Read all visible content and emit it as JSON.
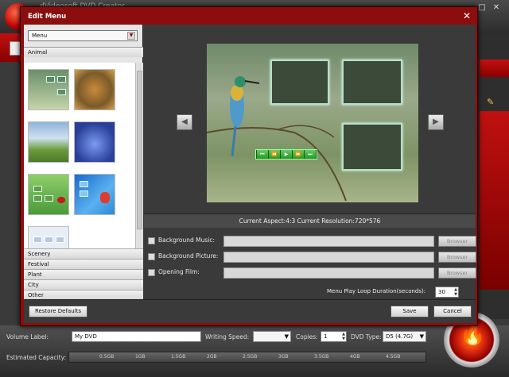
{
  "app": {
    "title": "dVideosoft DVD Creator",
    "minimize": "–",
    "maximize": "□",
    "close": "✕"
  },
  "dialog": {
    "title": "Edit Menu",
    "close": "✕",
    "menu_select": "Menu",
    "categories": [
      "Animal",
      "Scenery",
      "Festival",
      "Plant",
      "City",
      "Other"
    ],
    "info": "Current Aspect:4:3    Current Resolution:720*576",
    "options": {
      "background_music": "Background Music:",
      "background_picture": "Background Picture:",
      "opening_film": "Opening Film:",
      "browse": "Browser"
    },
    "loop_label": "Menu Play Loop Duration(seconds):",
    "loop_value": "30",
    "buttons": {
      "restore": "Restore Defaults",
      "save": "Save",
      "cancel": "Cancel"
    }
  },
  "bottom": {
    "volume_label": "Volume Label:",
    "volume_value": "My DVD",
    "writing_speed": "Writing Speed:",
    "copies": "Copies:",
    "copies_value": "1",
    "dvd_type": "DVD Type:",
    "dvd_type_value": "D5 (4.7G)",
    "estimated_capacity": "Estimated Capacity:",
    "capacity_ticks": [
      "0.5GB",
      "1GB",
      "1.5GB",
      "2GB",
      "2.5GB",
      "3GB",
      "3.5GB",
      "4GB",
      "4.5GB"
    ]
  },
  "icons": {
    "logo": "app-logo-icon",
    "burn": "burn-flame-icon",
    "edit": "edit-pencil-icon"
  }
}
